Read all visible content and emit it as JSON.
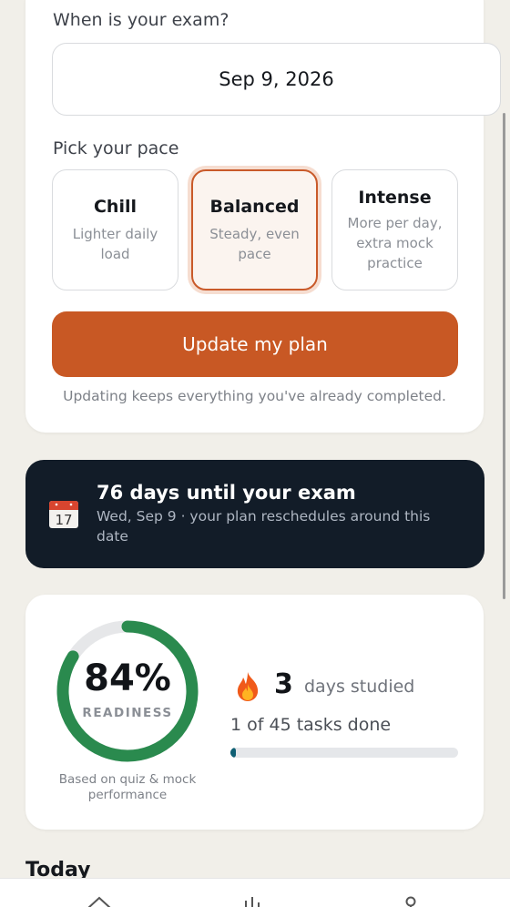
{
  "exam": {
    "question": "When is your exam?",
    "date": "Sep 9, 2026"
  },
  "pace": {
    "label": "Pick your pace",
    "selected": "Balanced",
    "options": [
      {
        "title": "Chill",
        "desc": "Lighter daily load"
      },
      {
        "title": "Balanced",
        "desc": "Steady, even pace"
      },
      {
        "title": "Intense",
        "desc": "More per day, extra mock practice"
      }
    ]
  },
  "update": {
    "button": "Update my plan",
    "note": "Updating keeps everything you've already completed."
  },
  "banner": {
    "icon": "calendar-icon",
    "calendar_day": "17",
    "title": "76 days until your exam",
    "subtitle": "Wed, Sep 9 · your plan reschedules around this date"
  },
  "stats": {
    "readiness_percent": 84,
    "readiness_text": "84%",
    "readiness_label": "READINESS",
    "readiness_caption": "Based on quiz & mock performance",
    "streak_icon": "fire-icon",
    "streak_count": "3",
    "streak_label": "days studied",
    "tasks_text": "1 of 45 tasks done",
    "tasks_done": 1,
    "tasks_total": 45
  },
  "section_heading": "Today",
  "nav": {
    "items": [
      {
        "icon": "home-icon"
      },
      {
        "icon": "bar-chart-icon"
      },
      {
        "icon": "profile-icon"
      }
    ]
  },
  "colors": {
    "accent": "#c85824",
    "ring": "#2a8a4e",
    "banner": "#121c28",
    "progress": "#0f5f73"
  }
}
